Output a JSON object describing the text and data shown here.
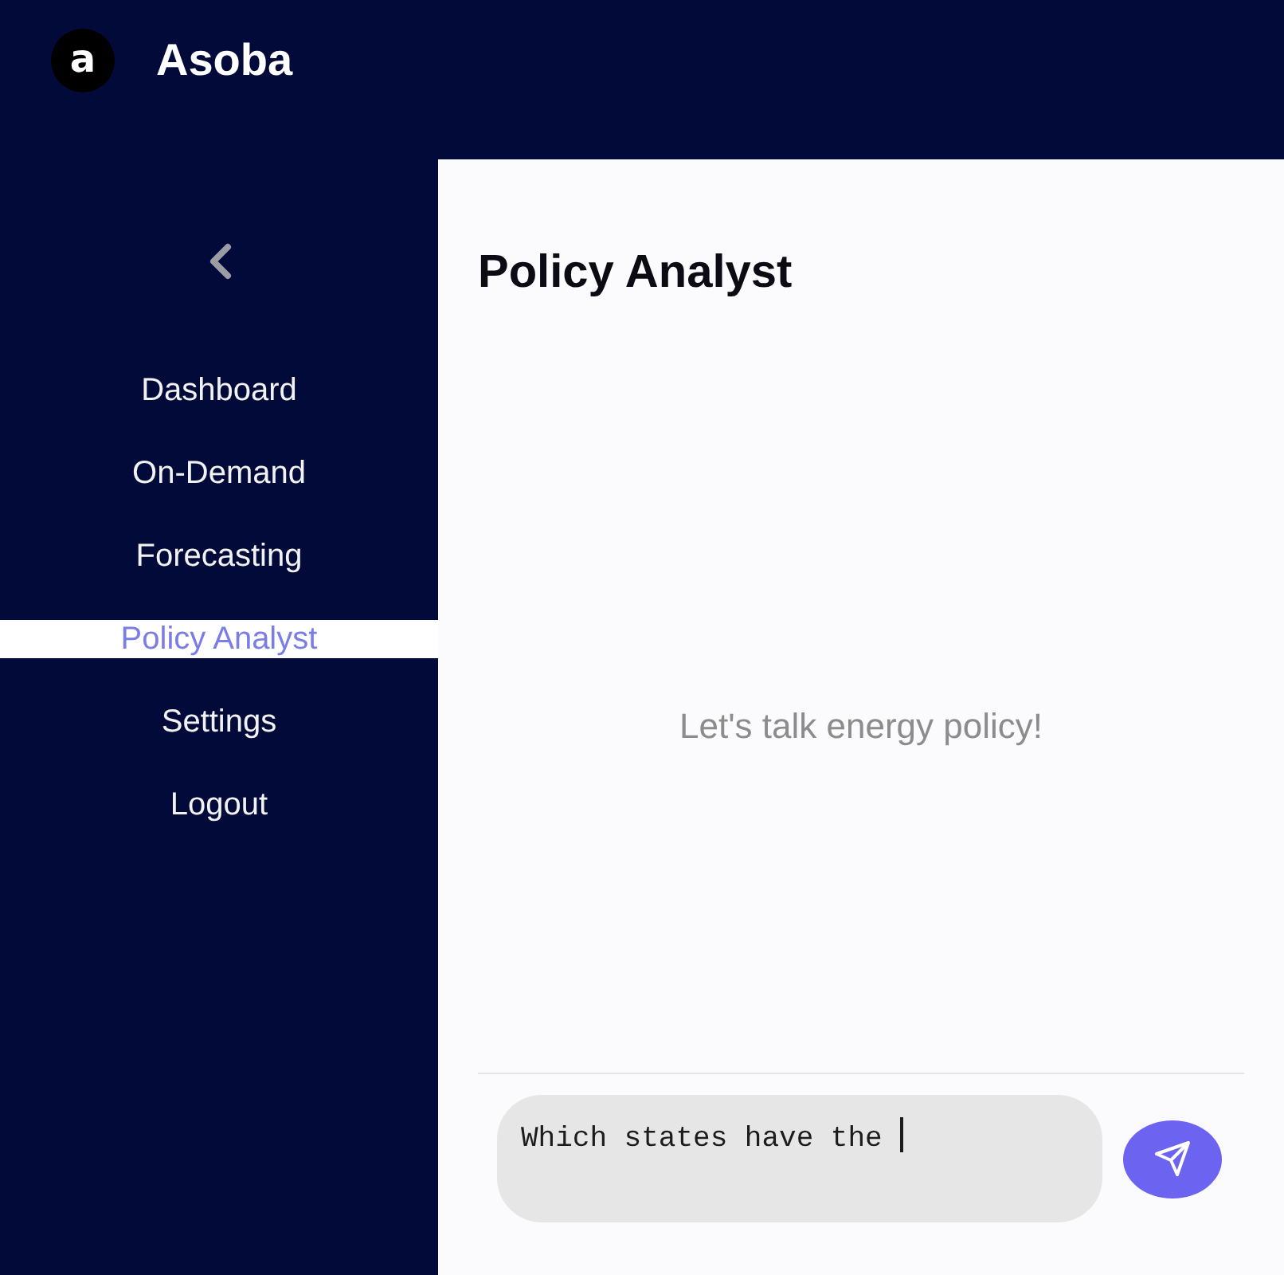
{
  "header": {
    "logo_mark": "a",
    "brand": "Asoba"
  },
  "sidebar": {
    "items": [
      {
        "label": "Dashboard",
        "selected": false
      },
      {
        "label": "On-Demand",
        "selected": false
      },
      {
        "label": "Forecasting",
        "selected": false
      },
      {
        "label": "Policy Analyst",
        "selected": true
      },
      {
        "label": "Settings",
        "selected": false
      },
      {
        "label": "Logout",
        "selected": false
      }
    ]
  },
  "chat": {
    "title": "Policy Analyst",
    "empty_message": "Let's talk energy policy!",
    "input": {
      "value": "Which states have the",
      "focused": true
    }
  }
}
